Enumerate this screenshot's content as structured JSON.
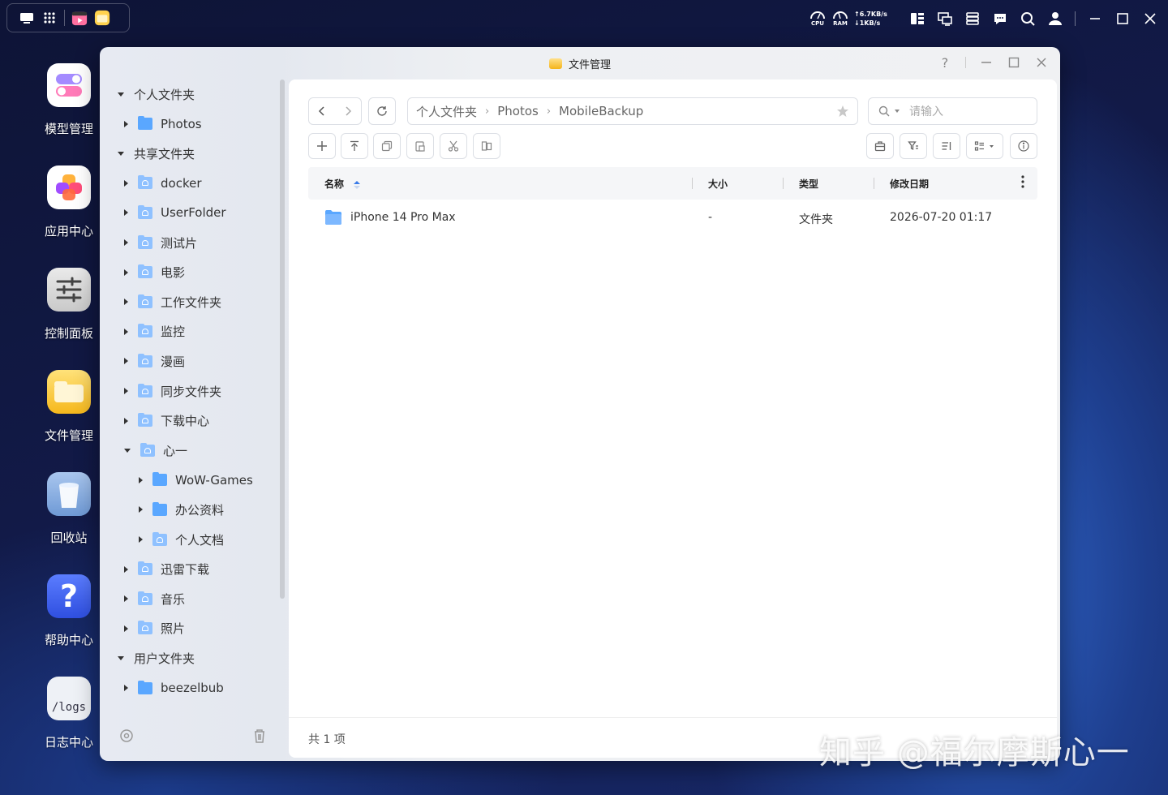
{
  "window": {
    "title": "文件管理",
    "help_label": "?"
  },
  "tray": {
    "cpu_label": "CPU",
    "ram_label": "RAM",
    "net_up": "↑6.7KB/s",
    "net_down": "↓1KB/s"
  },
  "dock": [
    {
      "label": "模型管理",
      "icon": "toggle-icon"
    },
    {
      "label": "应用中心",
      "icon": "apps-icon"
    },
    {
      "label": "控制面板",
      "icon": "sliders-icon"
    },
    {
      "label": "文件管理",
      "icon": "folder-icon"
    },
    {
      "label": "回收站",
      "icon": "trash-icon"
    },
    {
      "label": "帮助中心",
      "icon": "help-icon",
      "glyph": "?"
    },
    {
      "label": "日志中心",
      "icon": "logs-icon",
      "glyph": "/logs"
    }
  ],
  "sidebar": {
    "tree": [
      {
        "label": "个人文件夹",
        "level": 0,
        "caret": "down",
        "icon": "none"
      },
      {
        "label": "Photos",
        "level": 1,
        "caret": "right",
        "icon": "folder"
      },
      {
        "label": "共享文件夹",
        "level": 0,
        "caret": "down",
        "icon": "none"
      },
      {
        "label": "docker",
        "level": 1,
        "caret": "right",
        "icon": "shared"
      },
      {
        "label": "UserFolder",
        "level": 1,
        "caret": "right",
        "icon": "shared"
      },
      {
        "label": "测试片",
        "level": 1,
        "caret": "right",
        "icon": "shared"
      },
      {
        "label": "电影",
        "level": 1,
        "caret": "right",
        "icon": "shared"
      },
      {
        "label": "工作文件夹",
        "level": 1,
        "caret": "right",
        "icon": "shared"
      },
      {
        "label": "监控",
        "level": 1,
        "caret": "right",
        "icon": "shared"
      },
      {
        "label": "漫画",
        "level": 1,
        "caret": "right",
        "icon": "shared"
      },
      {
        "label": "同步文件夹",
        "level": 1,
        "caret": "right",
        "icon": "shared"
      },
      {
        "label": "下载中心",
        "level": 1,
        "caret": "right",
        "icon": "shared"
      },
      {
        "label": "心一",
        "level": 1,
        "caret": "down",
        "icon": "shared"
      },
      {
        "label": "WoW-Games",
        "level": 2,
        "caret": "right",
        "icon": "folder"
      },
      {
        "label": "办公资料",
        "level": 2,
        "caret": "right",
        "icon": "folder"
      },
      {
        "label": "个人文档",
        "level": 2,
        "caret": "right",
        "icon": "shared"
      },
      {
        "label": "迅雷下载",
        "level": 1,
        "caret": "right",
        "icon": "shared"
      },
      {
        "label": "音乐",
        "level": 1,
        "caret": "right",
        "icon": "shared"
      },
      {
        "label": "照片",
        "level": 1,
        "caret": "right",
        "icon": "shared"
      },
      {
        "label": "用户文件夹",
        "level": 0,
        "caret": "down",
        "icon": "none"
      },
      {
        "label": "beezelbub",
        "level": 1,
        "caret": "right",
        "icon": "folder"
      }
    ]
  },
  "breadcrumb": [
    "个人文件夹",
    "Photos",
    "MobileBackup"
  ],
  "search": {
    "placeholder": "请输入"
  },
  "table": {
    "columns": [
      "名称",
      "大小",
      "类型",
      "修改日期"
    ],
    "rows": [
      {
        "name": "iPhone 14 Pro Max",
        "size": "-",
        "type": "文件夹",
        "modified": "2026-07-20 01:17"
      }
    ]
  },
  "status": {
    "count_text": "共 1 项"
  },
  "watermark": "知乎 @福尔摩斯心一"
}
